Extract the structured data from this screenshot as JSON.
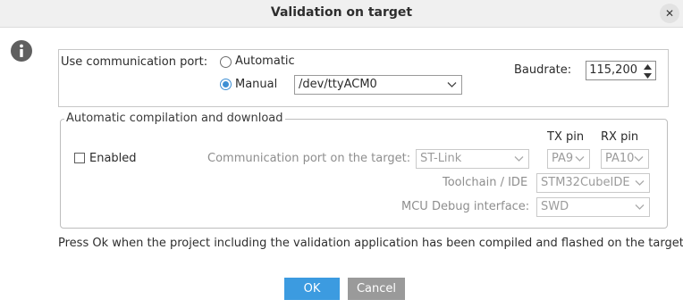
{
  "dialog": {
    "title": "Validation on target",
    "close_icon": "close-icon",
    "info_icon": "info-icon"
  },
  "communication": {
    "label": "Use communication port:",
    "automatic_label": "Automatic",
    "manual_label": "Manual",
    "selected_mode": "Manual",
    "port_value": "/dev/ttyACM0",
    "baudrate_label": "Baudrate:",
    "baudrate_value": "115,200"
  },
  "compilation": {
    "group_title": "Automatic compilation and download",
    "enabled_label": "Enabled",
    "enabled_checked": false,
    "comm_port_label": "Communication port on the target:",
    "comm_port_value": "ST-Link",
    "tx_pin_header": "TX pin",
    "rx_pin_header": "RX pin",
    "tx_pin_value": "PA9",
    "rx_pin_value": "PA10",
    "toolchain_label": "Toolchain / IDE",
    "toolchain_value": "STM32CubeIDE",
    "mcu_debug_label": "MCU Debug interface:",
    "mcu_debug_value": "SWD"
  },
  "message": "Press Ok when the project including the validation application has been compiled and flashed on the target.",
  "buttons": {
    "ok_label": "OK",
    "cancel_label": "Cancel"
  },
  "colors": {
    "accent": "#3c9be0",
    "cancel": "#9a9a9a"
  }
}
